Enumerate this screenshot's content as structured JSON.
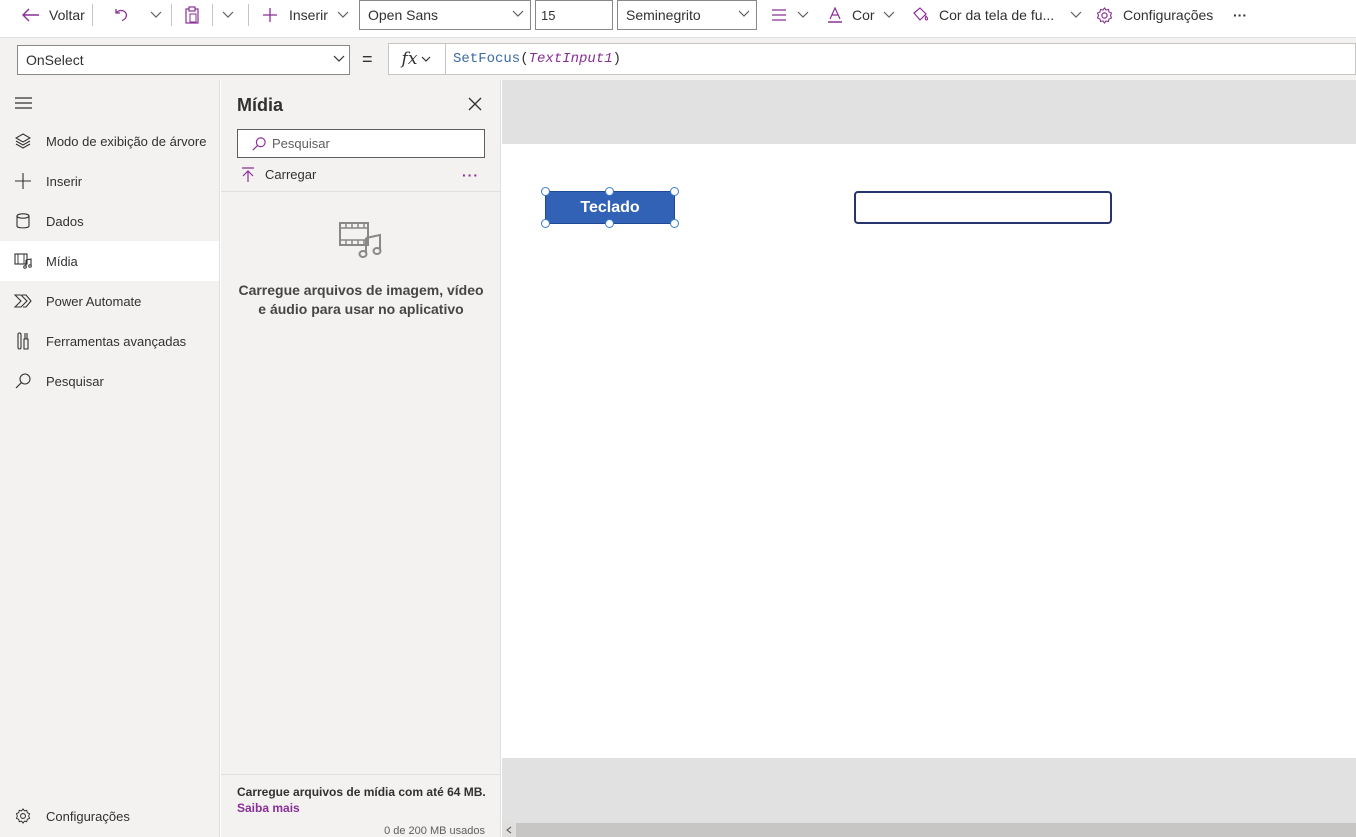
{
  "toolbar": {
    "back_label": "Voltar",
    "insert_label": "Inserir",
    "font_family": "Open Sans",
    "font_size": "15",
    "font_weight": "Seminegrito",
    "color_label": "Cor",
    "screen_fill_label": "Cor da tela de fu...",
    "settings_label": "Configurações",
    "more_label": "···"
  },
  "formula_bar": {
    "property": "OnSelect",
    "equals": "=",
    "fx_label": "fx",
    "function_name": "SetFocus",
    "open_paren": "(",
    "argument": "TextInput1",
    "close_paren": ")"
  },
  "rail": {
    "items": [
      {
        "label": "Modo de exibição de árvore",
        "icon": "layers-icon"
      },
      {
        "label": "Inserir",
        "icon": "plus-icon"
      },
      {
        "label": "Dados",
        "icon": "database-icon"
      },
      {
        "label": "Mídia",
        "icon": "media-icon",
        "active": true
      },
      {
        "label": "Power Automate",
        "icon": "power-automate-icon"
      },
      {
        "label": "Ferramentas avançadas",
        "icon": "tools-icon"
      },
      {
        "label": "Pesquisar",
        "icon": "search-icon"
      }
    ],
    "settings_label": "Configurações"
  },
  "media_pane": {
    "title": "Mídia",
    "search_placeholder": "Pesquisar",
    "upload_label": "Carregar",
    "more_label": "···",
    "empty_message": "Carregue arquivos de imagem, vídeo e áudio para usar no aplicativo",
    "limit_text": "Carregue arquivos de mídia com até 64 MB.",
    "learn_more": "Saiba mais",
    "usage_text": "0 de 200 MB usados"
  },
  "canvas": {
    "button_text": "Teclado",
    "text_input_value": ""
  },
  "colors": {
    "accent": "#8a2f97",
    "button_fill": "#3262b6",
    "input_border": "#27336b"
  }
}
